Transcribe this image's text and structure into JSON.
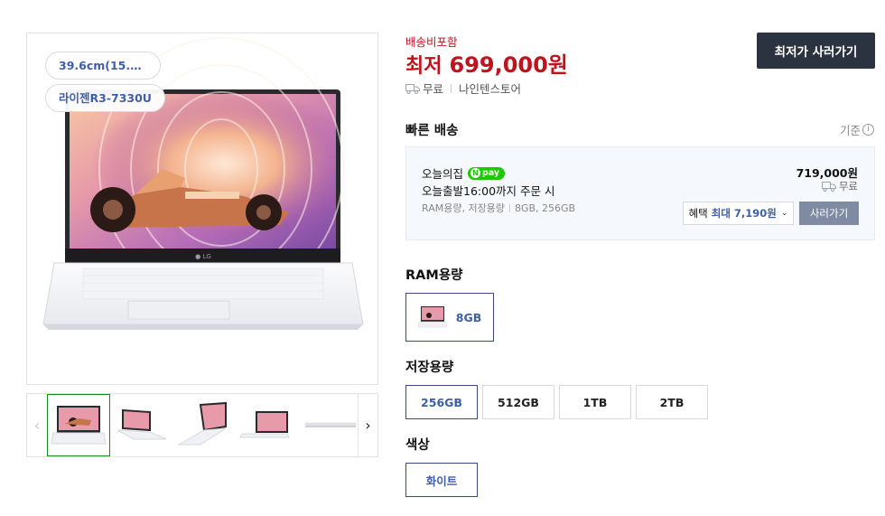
{
  "product": {
    "spec_chips": [
      "39.6cm(15.6인...",
      "라이젠R3-7330U"
    ],
    "shipping_label": "배송비포함",
    "price_prefix": "최저",
    "price": "699,000원",
    "delivery": "무료",
    "seller": "나인텐스토어",
    "buy_label": "최저가 사러가기"
  },
  "fast_delivery": {
    "title": "빠른 배송",
    "criteria": "기준",
    "store": "오늘의집",
    "pay_badge": "pay",
    "deadline": "오늘출발16:00까지 주문 시",
    "option_names": "RAM용량, 저장용량",
    "option_values": "8GB, 256GB",
    "price": "719,000원",
    "delivery": "무료",
    "benefit_label": "혜택",
    "benefit_value": "최대 7,190원",
    "buy_label": "사러가기"
  },
  "options": {
    "ram": {
      "title": "RAM용량",
      "items": [
        "8GB"
      ],
      "selected": "8GB"
    },
    "storage": {
      "title": "저장용량",
      "items": [
        "256GB",
        "512GB",
        "1TB",
        "2TB"
      ],
      "selected": "256GB"
    },
    "color": {
      "title": "색상",
      "items": [
        "화이트"
      ],
      "selected": "화이트"
    }
  },
  "colors": {
    "price_red": "#c1121f",
    "accent_blue": "#3f5ea8",
    "dark_button": "#2c3340",
    "thumb_active": "#1d8a1d"
  }
}
